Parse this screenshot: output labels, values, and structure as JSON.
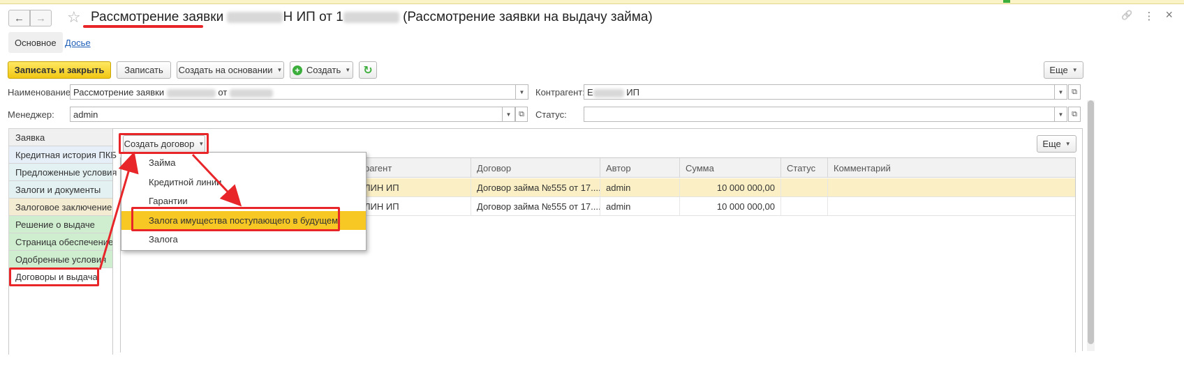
{
  "window": {
    "title_prefix": "Рассмотрение заявки",
    "title_mid": "Н ИП от 1",
    "title_suffix": "(Рассмотрение заявки на выдачу займа)"
  },
  "section_tabs": {
    "main": "Основное",
    "dossier": "Досье"
  },
  "toolbar": {
    "save_close": "Записать и закрыть",
    "save": "Записать",
    "create_based": "Создать на основании",
    "create": "Создать",
    "more": "Еще"
  },
  "form": {
    "name_label": "Наименование:",
    "name_value_prefix": "Рассмотрение заявки",
    "name_value_mid": "от",
    "manager_label": "Менеджер:",
    "manager_value": "admin",
    "counterparty_label": "Контрагент:",
    "counterparty_value_prefix": "Е",
    "counterparty_value_suffix": "ИП",
    "status_label": "Статус:",
    "status_value": ""
  },
  "side_tabs": [
    {
      "label": "Заявка",
      "color": "#f0f0f0"
    },
    {
      "label": "Кредитная история ПКБ",
      "color": "#e6eef7"
    },
    {
      "label": "Предложенные условия",
      "color": "#e3f1f2"
    },
    {
      "label": "Залоги и документы",
      "color": "#e3f1f2"
    },
    {
      "label": "Залоговое заключение",
      "color": "#f4ecd2"
    },
    {
      "label": "Решение о выдаче",
      "color": "#cfedcf"
    },
    {
      "label": "Страница обеспечение",
      "color": "#cfedcf"
    },
    {
      "label": "Одобренные условия",
      "color": "#cfedcf"
    },
    {
      "label": "Договоры и выдача",
      "color": "#ffffff"
    }
  ],
  "panel": {
    "create_contract_button": "Создать договор",
    "more": "Еще"
  },
  "dropdown_items": [
    "Займа",
    "Кредитной линии",
    "Гарантии",
    "Залога имущества поступающего в будущем",
    "Залога"
  ],
  "grid": {
    "headers": [
      "рагент",
      "Договор",
      "Автор",
      "Сумма",
      "Статус",
      "Комментарий"
    ],
    "rows": [
      {
        "counterparty": "ЛИН ИП",
        "contract": "Договор займа №555 от 17....",
        "author": "admin",
        "amount": "10 000 000,00",
        "status": "",
        "comment": ""
      },
      {
        "counterparty": "ЛИН ИП",
        "contract": "Договор займа №555 от 17....",
        "author": "admin",
        "amount": "10 000 000,00",
        "status": "",
        "comment": ""
      }
    ]
  },
  "icons": {
    "back": "←",
    "forward": "→",
    "star": "☆",
    "link": "🔗",
    "menu": "⋮",
    "close": "×",
    "caret": "▼",
    "plus": "+",
    "refresh": "↻",
    "open": "⧉"
  },
  "colors": {
    "primary_button": "#f1c714",
    "highlight": "#f7c823",
    "annotation": "#e8262a",
    "selected_row": "#fbf0c5"
  }
}
